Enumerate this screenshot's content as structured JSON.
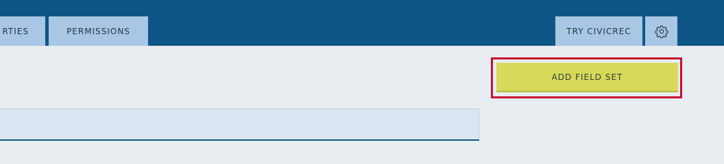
{
  "nav": {
    "tabs": {
      "properties": "RTIES",
      "permissions": "PERMISSIONS",
      "try_civicrec": "TRY CIVICREC"
    },
    "settings_icon": "gear-icon"
  },
  "main": {
    "add_field_set_label": "ADD FIELD SET"
  },
  "colors": {
    "topbar": "#0d5586",
    "tab": "#a9c6e4",
    "page_bg": "#e8edf2",
    "add_button": "#d6d959",
    "highlight_outline": "#c8102e"
  }
}
